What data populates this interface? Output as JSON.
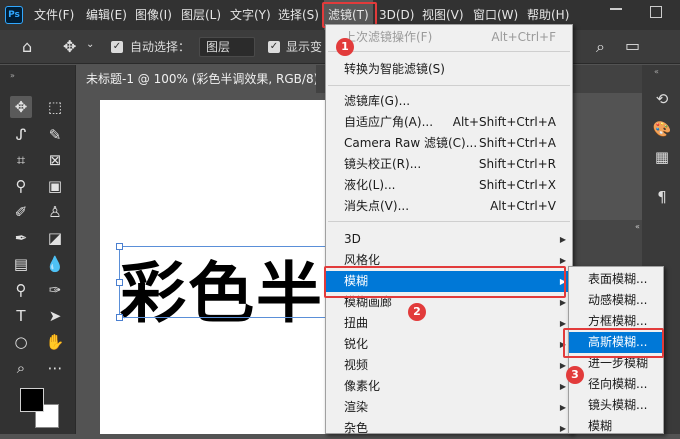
{
  "app": {
    "logo": "Ps"
  },
  "menubar": {
    "items": [
      {
        "label": "文件(F)"
      },
      {
        "label": "编辑(E)"
      },
      {
        "label": "图像(I)"
      },
      {
        "label": "图层(L)"
      },
      {
        "label": "文字(Y)"
      },
      {
        "label": "选择(S)"
      },
      {
        "label": "滤镜(T)"
      },
      {
        "label": "3D(D)"
      },
      {
        "label": "视图(V)"
      },
      {
        "label": "窗口(W)"
      },
      {
        "label": "帮助(H)"
      }
    ]
  },
  "optionsbar": {
    "auto_select_label": "自动选择：",
    "auto_select_value": "图层",
    "show_transform_label": "显示变"
  },
  "document": {
    "tab_title": "未标题-1 @ 100% (彩色半调效果, RGB/8) *",
    "canvas_text": "彩色半"
  },
  "filter_menu": {
    "items": [
      {
        "label": "上次滤镜操作(F)",
        "shortcut": "Alt+Ctrl+F"
      },
      {
        "label": "转换为智能滤镜(S)",
        "shortcut": ""
      },
      {
        "label": "滤镜库(G)...",
        "shortcut": ""
      },
      {
        "label": "自适应广角(A)...",
        "shortcut": "Alt+Shift+Ctrl+A"
      },
      {
        "label": "Camera Raw 滤镜(C)...",
        "shortcut": "Shift+Ctrl+A"
      },
      {
        "label": "镜头校正(R)...",
        "shortcut": "Shift+Ctrl+R"
      },
      {
        "label": "液化(L)...",
        "shortcut": "Shift+Ctrl+X"
      },
      {
        "label": "消失点(V)...",
        "shortcut": "Alt+Ctrl+V"
      },
      {
        "label": "3D"
      },
      {
        "label": "风格化"
      },
      {
        "label": "模糊"
      },
      {
        "label": "模糊画廊"
      },
      {
        "label": "扭曲"
      },
      {
        "label": "锐化"
      },
      {
        "label": "视频"
      },
      {
        "label": "像素化"
      },
      {
        "label": "渲染"
      },
      {
        "label": "杂色"
      }
    ]
  },
  "blur_submenu": {
    "items": [
      {
        "label": "表面模糊..."
      },
      {
        "label": "动感模糊..."
      },
      {
        "label": "方框模糊..."
      },
      {
        "label": "高斯模糊..."
      },
      {
        "label": "进一步模糊"
      },
      {
        "label": "径向模糊..."
      },
      {
        "label": "镜头模糊..."
      },
      {
        "label": "模糊"
      }
    ]
  },
  "step_badges": [
    "1",
    "2",
    "3"
  ],
  "colors": {
    "highlight": "#0078d7",
    "annotation": "#e23b3b",
    "foreground": "#000000",
    "background": "#ffffff"
  }
}
